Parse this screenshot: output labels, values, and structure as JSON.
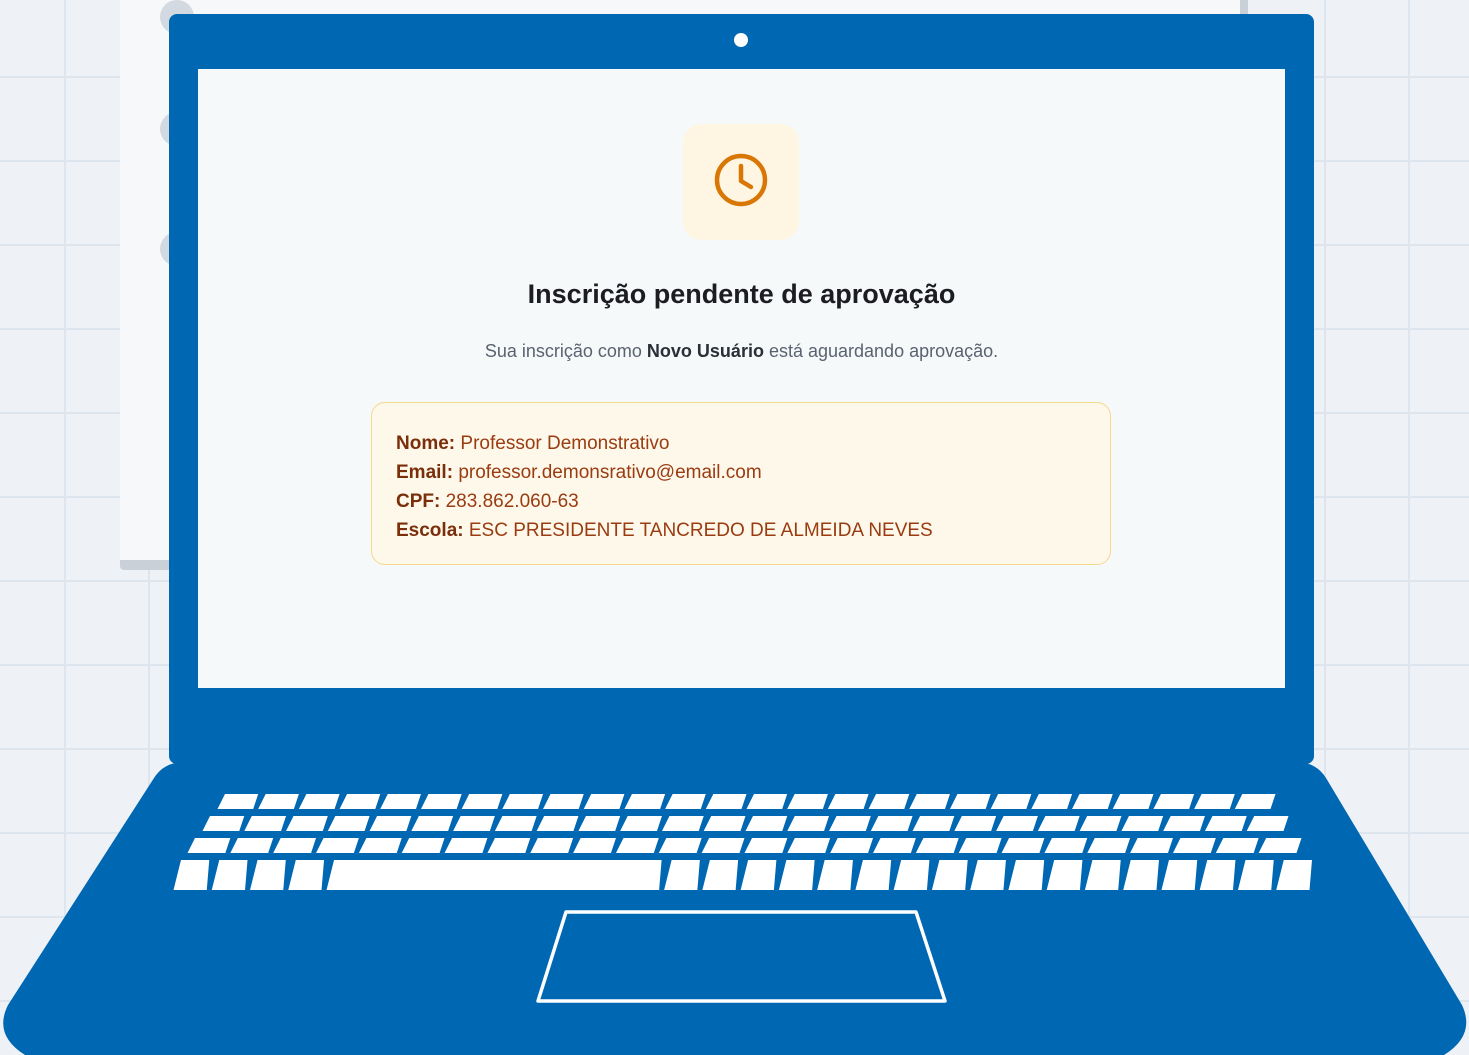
{
  "status": {
    "icon": "clock-icon",
    "icon_color": "#d97706",
    "title": "Inscrição pendente de aprovação",
    "message_prefix": "Sua inscrição como",
    "role": "Novo Usuário",
    "message_suffix": "está aguardando aprovação."
  },
  "details": [
    {
      "label": "Nome:",
      "value": "Professor Demonstrativo"
    },
    {
      "label": "Email:",
      "value": "professor.demonsrativo@email.com"
    },
    {
      "label": "CPF:",
      "value": "283.862.060-63"
    },
    {
      "label": "Escola:",
      "value": "ESC PRESIDENTE TANCREDO DE ALMEIDA NEVES"
    }
  ],
  "colors": {
    "laptop": "#0067b3",
    "card_background": "#fef8eb",
    "card_border": "#f5d98a",
    "card_text": "#9a3b10"
  }
}
